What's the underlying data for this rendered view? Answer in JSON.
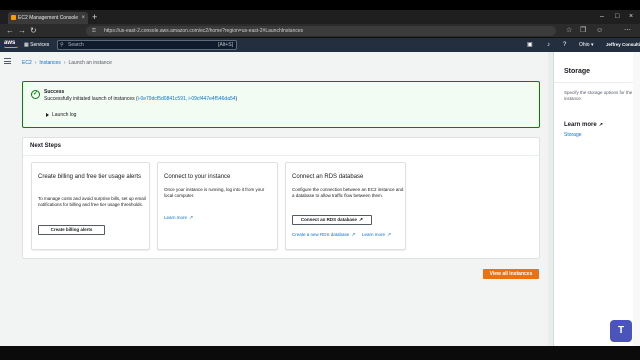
{
  "browser": {
    "tab_title": "EC2 Management Console",
    "new_tab": "+",
    "url": "https://us-east-2.console.aws.amazon.com/ec2/home?region=us-east-2#LaunchInstances"
  },
  "aws_header": {
    "logo": "aws",
    "services": "Services",
    "search_placeholder": "Search",
    "search_shortcut": "[Alt+S]",
    "region": "Ohio",
    "account": "Jeffrey Consulting"
  },
  "breadcrumb": [
    "EC2",
    "Instances",
    "Launch an instance"
  ],
  "success": {
    "title": "Success",
    "message_prefix": "Successfully initiated launch of instances (",
    "instances": "i-0e79dcf5d0841c591, i-09cf447e4f546da54",
    "message_suffix": ")",
    "launch_log": "Launch log"
  },
  "next_steps": {
    "title": "Next Steps",
    "cards": [
      {
        "title": "Create billing and free tier usage alerts",
        "body": "To manage costs and avoid surprise bills, set up email notifications for billing and free tier usage thresholds.",
        "button": "Create billing alerts"
      },
      {
        "title": "Connect to your instance",
        "body": "Once your instance is running, log into it from your local computer.",
        "link": "Learn more"
      },
      {
        "title": "Connect an RDS database",
        "body": "Configure the connection between an EC2 instance and a database to allow traffic flow between them.",
        "button": "Connect an RDS database",
        "link1": "Create a new RDS database",
        "link2": "Learn more"
      }
    ]
  },
  "view_all_button": "View all instances",
  "side_panel": {
    "title": "Storage",
    "body": "Specify the storage options for the instance.",
    "learn_more": "Learn more",
    "link": "Storage"
  },
  "colors": {
    "accent": "#ec7211",
    "link": "#0972d3",
    "success": "#037f0c",
    "header": "#232f3e"
  }
}
